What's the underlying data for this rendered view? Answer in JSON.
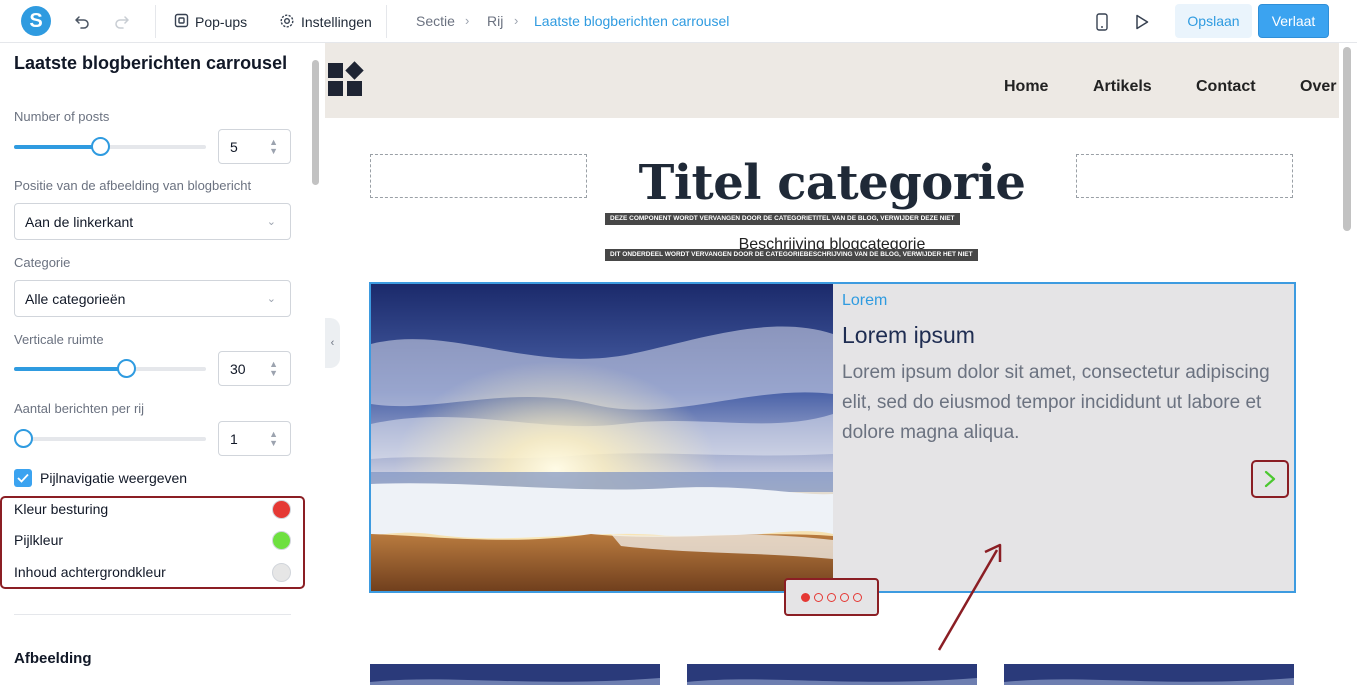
{
  "topbar": {
    "logo_letter": "S",
    "popups_label": "Pop-ups",
    "settings_label": "Instellingen",
    "breadcrumb": [
      "Sectie",
      "Rij",
      "Laatste blogberichten carrousel"
    ],
    "save_label": "Opslaan",
    "leave_label": "Verlaat"
  },
  "panel": {
    "title": "Laatste blogberichten carrousel",
    "posts": {
      "label": "Number of posts",
      "value": "5",
      "level": 0.45
    },
    "image_position": {
      "label": "Positie van de afbeelding van blogbericht",
      "value": "Aan de linkerkant"
    },
    "category": {
      "label": "Categorie",
      "value": "Alle categorieën"
    },
    "vertical_space": {
      "label": "Verticale ruimte",
      "value": "30",
      "level": 0.59
    },
    "per_row": {
      "label": "Aantal berichten per rij",
      "value": "1",
      "level": 0.0
    },
    "arrows": {
      "label": "Pijlnavigatie weergeven",
      "checked": true
    },
    "colors": [
      {
        "label": "Kleur besturing",
        "color": "#e53935"
      },
      {
        "label": "Pijlkleur",
        "color": "#6ee03f"
      },
      {
        "label": "Inhoud achtergrondkleur",
        "color": "#e6e6e6"
      }
    ],
    "section_heading": "Afbeelding"
  },
  "site": {
    "nav": [
      "Home",
      "Artikels",
      "Contact",
      "Over"
    ],
    "category_title": "Titel categorie",
    "title_notice": "DEZE COMPONENT WORDT VERVANGEN DOOR DE CATEGORIETITEL VAN DE BLOG, VERWIJDER DEZE NIET",
    "category_description": "Beschrijving blogcategorie",
    "description_notice": "DIT ONDERDEEL WORDT VERVANGEN DOOR DE CATEGORIEBESCHRIJVING VAN DE BLOG, VERWIJDER HET NIET"
  },
  "carousel": {
    "category": "Lorem",
    "title": "Lorem ipsum",
    "body": "Lorem ipsum dolor sit amet, consectetur adipiscing elit, sed do eiusmod tempor incididunt ut labore et dolore magna aliqua.",
    "dot_count": 5,
    "active_dot": 0,
    "arrow_color": "#4cc830",
    "dot_color": "#e53935"
  }
}
